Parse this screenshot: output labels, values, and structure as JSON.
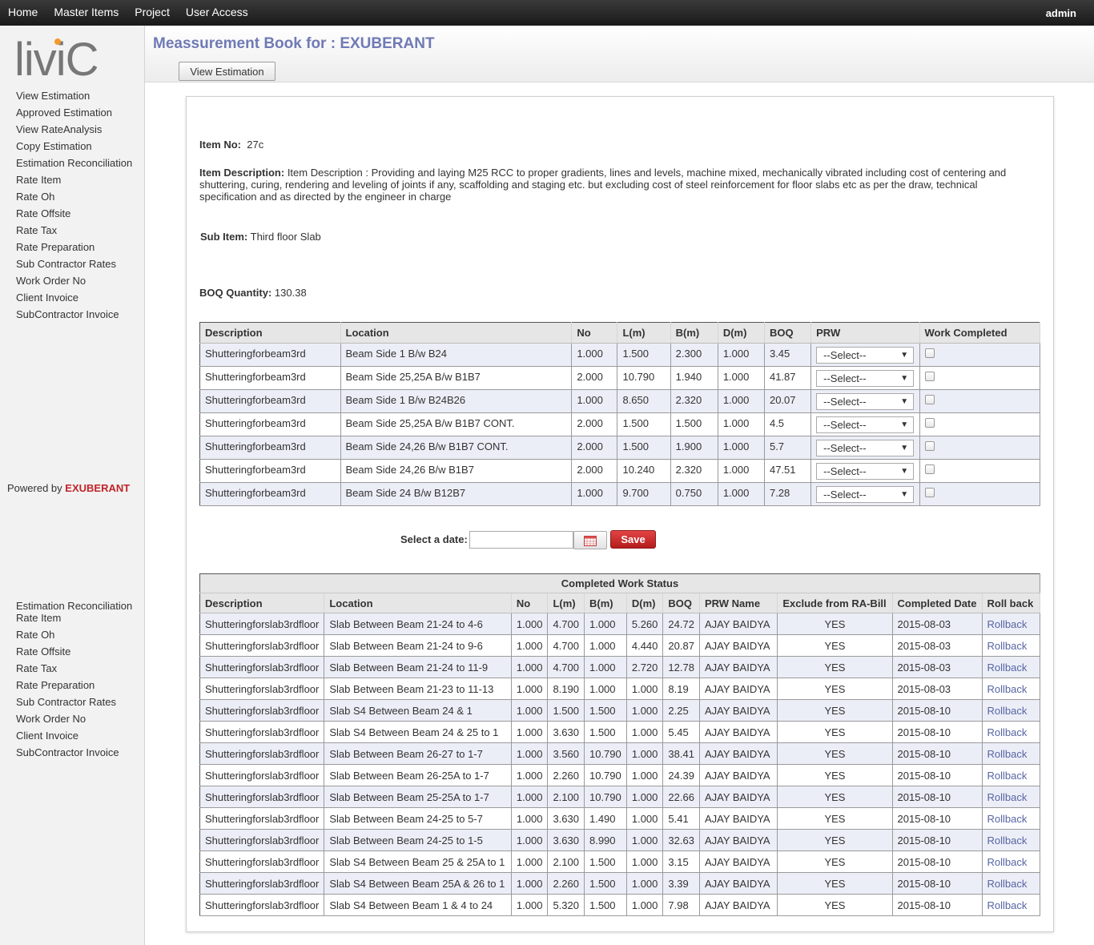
{
  "nav": {
    "items": [
      "Home",
      "Master Items",
      "Project",
      "User Access"
    ],
    "user": "admin"
  },
  "sidebar": {
    "logo_text": "liviC",
    "menu_top": [
      "View Estimation",
      "Approved Estimation",
      "View RateAnalysis",
      "Copy Estimation",
      "Estimation Reconciliation",
      "Rate Item",
      "Rate Oh",
      "Rate Offsite",
      "Rate Tax",
      "Rate Preparation",
      "Sub Contractor Rates",
      "Work Order No",
      "Client Invoice",
      "SubContractor Invoice"
    ],
    "powered_label": "Powered by",
    "powered_brand": "EXUBERANT",
    "menu_bottom": [
      "Estimation Reconciliation",
      "Rate Item",
      "Rate Oh",
      "Rate Offsite",
      "Rate Tax",
      "Rate Preparation",
      "Sub Contractor Rates",
      "Work Order No",
      "Client Invoice",
      "SubContractor Invoice"
    ]
  },
  "header": {
    "title": "Meassurement Book for : EXUBERANT",
    "view_button": "View Estimation"
  },
  "item": {
    "no_label": "Item No:",
    "no_value": "27c",
    "desc_label": "Item Description:",
    "desc_value": "Item Description : Providing and laying M25 RCC to proper gradients, lines and levels, machine mixed, mechanically vibrated including cost of centering and shuttering, curing, rendering and leveling of joints if any, scaffolding and staging etc. but excluding cost of steel reinforcement for floor slabs etc as per the draw, technical specification and as directed by the engineer in charge",
    "sub_label": "Sub Item:",
    "sub_value": "Third floor Slab",
    "boq_label": "BOQ Quantity:",
    "boq_value": "130.38"
  },
  "measure_table": {
    "headers": [
      "Description",
      "Location",
      "No",
      "L(m)",
      "B(m)",
      "D(m)",
      "BOQ",
      "PRW",
      "Work Completed"
    ],
    "select_placeholder": "--Select--",
    "rows": [
      [
        "Shutteringforbeam3rd",
        "Beam Side 1 B/w B24",
        "1.000",
        "1.500",
        "2.300",
        "1.000",
        "3.45"
      ],
      [
        "Shutteringforbeam3rd",
        "Beam Side 25,25A B/w B1B7",
        "2.000",
        "10.790",
        "1.940",
        "1.000",
        "41.87"
      ],
      [
        "Shutteringforbeam3rd",
        "Beam Side 1 B/w B24B26",
        "1.000",
        "8.650",
        "2.320",
        "1.000",
        "20.07"
      ],
      [
        "Shutteringforbeam3rd",
        "Beam Side 25,25A B/w B1B7 CONT.",
        "2.000",
        "1.500",
        "1.500",
        "1.000",
        "4.5"
      ],
      [
        "Shutteringforbeam3rd",
        "Beam Side 24,26 B/w B1B7 CONT.",
        "2.000",
        "1.500",
        "1.900",
        "1.000",
        "5.7"
      ],
      [
        "Shutteringforbeam3rd",
        "Beam Side 24,26 B/w B1B7",
        "2.000",
        "10.240",
        "2.320",
        "1.000",
        "47.51"
      ],
      [
        "Shutteringforbeam3rd",
        "Beam Side 24 B/w B12B7",
        "1.000",
        "9.700",
        "0.750",
        "1.000",
        "7.28"
      ]
    ]
  },
  "date_row": {
    "label": "Select a date:",
    "value": "",
    "save": "Save"
  },
  "completed_table": {
    "caption": "Completed Work Status",
    "headers": [
      "Description",
      "Location",
      "No",
      "L(m)",
      "B(m)",
      "D(m)",
      "BOQ",
      "PRW Name",
      "Exclude from RA-Bill",
      "Completed Date",
      "Roll back"
    ],
    "rows": [
      [
        "Shutteringforslab3rdfloor",
        "Slab Between Beam 21-24 to 4-6",
        "1.000",
        "4.700",
        "1.000",
        "5.260",
        "24.72",
        "AJAY BAIDYA",
        "YES",
        "2015-08-03",
        "Rollback"
      ],
      [
        "Shutteringforslab3rdfloor",
        "Slab Between Beam 21-24 to 9-6",
        "1.000",
        "4.700",
        "1.000",
        "4.440",
        "20.87",
        "AJAY BAIDYA",
        "YES",
        "2015-08-03",
        "Rollback"
      ],
      [
        "Shutteringforslab3rdfloor",
        "Slab Between Beam 21-24 to 11-9",
        "1.000",
        "4.700",
        "1.000",
        "2.720",
        "12.78",
        "AJAY BAIDYA",
        "YES",
        "2015-08-03",
        "Rollback"
      ],
      [
        "Shutteringforslab3rdfloor",
        "Slab Between Beam 21-23 to 11-13",
        "1.000",
        "8.190",
        "1.000",
        "1.000",
        "8.19",
        "AJAY BAIDYA",
        "YES",
        "2015-08-03",
        "Rollback"
      ],
      [
        "Shutteringforslab3rdfloor",
        "Slab S4 Between Beam 24 & 1",
        "1.000",
        "1.500",
        "1.500",
        "1.000",
        "2.25",
        "AJAY BAIDYA",
        "YES",
        "2015-08-10",
        "Rollback"
      ],
      [
        "Shutteringforslab3rdfloor",
        "Slab S4 Between Beam 24 & 25 to 1",
        "1.000",
        "3.630",
        "1.500",
        "1.000",
        "5.45",
        "AJAY BAIDYA",
        "YES",
        "2015-08-10",
        "Rollback"
      ],
      [
        "Shutteringforslab3rdfloor",
        "Slab Between Beam 26-27 to 1-7",
        "1.000",
        "3.560",
        "10.790",
        "1.000",
        "38.41",
        "AJAY BAIDYA",
        "YES",
        "2015-08-10",
        "Rollback"
      ],
      [
        "Shutteringforslab3rdfloor",
        "Slab Between Beam 26-25A to 1-7",
        "1.000",
        "2.260",
        "10.790",
        "1.000",
        "24.39",
        "AJAY BAIDYA",
        "YES",
        "2015-08-10",
        "Rollback"
      ],
      [
        "Shutteringforslab3rdfloor",
        "Slab Between Beam 25-25A to 1-7",
        "1.000",
        "2.100",
        "10.790",
        "1.000",
        "22.66",
        "AJAY BAIDYA",
        "YES",
        "2015-08-10",
        "Rollback"
      ],
      [
        "Shutteringforslab3rdfloor",
        "Slab Between Beam 24-25 to 5-7",
        "1.000",
        "3.630",
        "1.490",
        "1.000",
        "5.41",
        "AJAY BAIDYA",
        "YES",
        "2015-08-10",
        "Rollback"
      ],
      [
        "Shutteringforslab3rdfloor",
        "Slab Between Beam 24-25 to 1-5",
        "1.000",
        "3.630",
        "8.990",
        "1.000",
        "32.63",
        "AJAY BAIDYA",
        "YES",
        "2015-08-10",
        "Rollback"
      ],
      [
        "Shutteringforslab3rdfloor",
        "Slab S4 Between Beam 25 & 25A to 1",
        "1.000",
        "2.100",
        "1.500",
        "1.000",
        "3.15",
        "AJAY BAIDYA",
        "YES",
        "2015-08-10",
        "Rollback"
      ],
      [
        "Shutteringforslab3rdfloor",
        "Slab S4 Between Beam 25A & 26 to 1",
        "1.000",
        "2.260",
        "1.500",
        "1.000",
        "3.39",
        "AJAY BAIDYA",
        "YES",
        "2015-08-10",
        "Rollback"
      ],
      [
        "Shutteringforslab3rdfloor",
        "Slab S4 Between Beam 1 & 4 to 24",
        "1.000",
        "5.320",
        "1.500",
        "1.000",
        "7.98",
        "AJAY BAIDYA",
        "YES",
        "2015-08-10",
        "Rollback"
      ]
    ]
  }
}
